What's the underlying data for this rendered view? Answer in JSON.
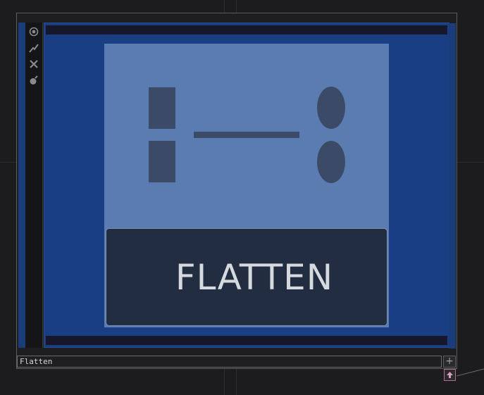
{
  "node": {
    "name": "Flatten",
    "thumbnail_caption": "FLATTEN"
  },
  "side_buttons": [
    "viewer-toggle-icon",
    "bypass-icon",
    "close-icon",
    "cook-icon"
  ],
  "colors": {
    "viewer_bg": "#1a3e84",
    "thumbnail_bg": "#5b7cb1",
    "caption_bg": "#222d42",
    "frame": "#5c5c61"
  }
}
